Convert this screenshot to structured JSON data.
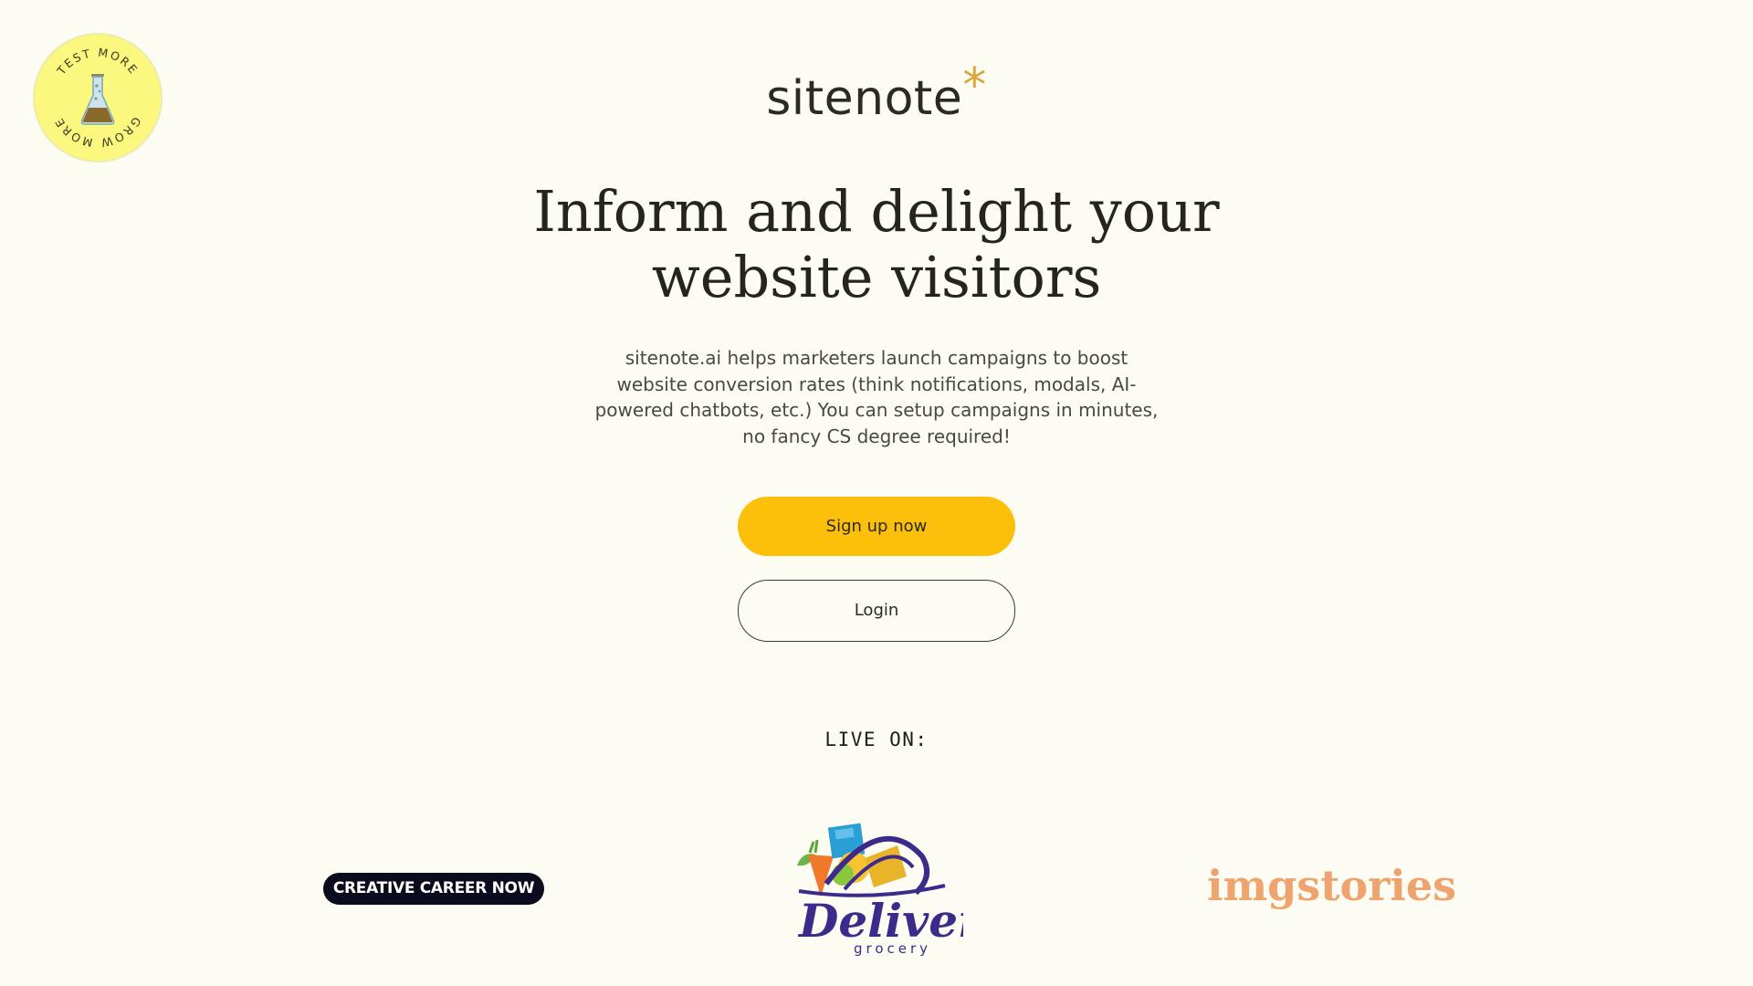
{
  "badge": {
    "top_text": "TEST MORE",
    "bottom_text": "GROW MORE",
    "icon": "flask-icon",
    "bg_color": "#fbf77f"
  },
  "brand": {
    "name": "sitenote",
    "mark": "*",
    "mark_color": "#d9a63a"
  },
  "hero": {
    "headline": "Inform and delight your website visitors",
    "description": "sitenote.ai helps marketers launch campaigns to boost website conversion rates (think notifications, modals, AI-powered chatbots, etc.) You can setup campaigns in minutes, no fancy CS degree required!"
  },
  "actions": {
    "signup_label": "Sign up now",
    "signup_color": "#fcbf0a",
    "login_label": "Login"
  },
  "customers": {
    "heading": "LIVE ON:",
    "logos": [
      {
        "name": "CREATIVE CAREER NOW"
      },
      {
        "name": "Deliver",
        "tagline": "grocery"
      },
      {
        "name": "imgstories",
        "color": "#eea46e"
      }
    ]
  }
}
